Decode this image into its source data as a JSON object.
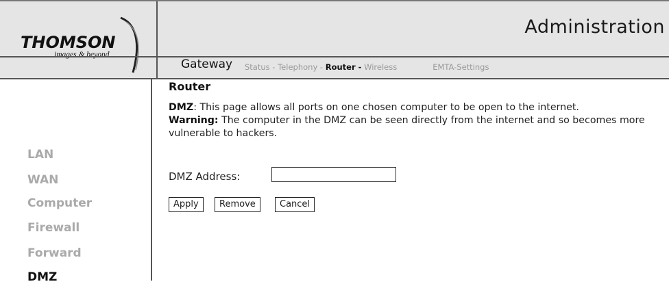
{
  "brand": {
    "name": "THOMSON",
    "tagline": "images & beyond"
  },
  "header": {
    "title": "Administration",
    "section": "Gateway",
    "nav": [
      {
        "label": "Status -",
        "active": false
      },
      {
        "label": "Telephony -",
        "active": false
      },
      {
        "label": "Router -",
        "active": true
      },
      {
        "label": "Wireless",
        "active": false
      },
      {
        "label": "EMTA-Settings",
        "active": false
      }
    ]
  },
  "sidebar": {
    "items": [
      {
        "label": "LAN",
        "active": false
      },
      {
        "label": "WAN",
        "active": false
      },
      {
        "label": "Computer",
        "active": false
      },
      {
        "label": "Firewall",
        "active": false
      },
      {
        "label": "Forward",
        "active": false
      },
      {
        "label": "DMZ",
        "active": true
      }
    ]
  },
  "main": {
    "title": "Router",
    "dmz_term": "DMZ",
    "dmz_desc": ": This page allows all ports on one chosen computer to be open to the internet.",
    "warning_term": "Warning:",
    "warning_desc": " The computer in the DMZ can be seen directly from the internet and so becomes more vulnerable to hackers.",
    "dmz_address_label": "DMZ Address:",
    "dmz_address_value": "",
    "buttons": {
      "apply": "Apply",
      "remove": "Remove",
      "cancel": "Cancel"
    }
  },
  "colors": {
    "header_bg": "#e5e5e5",
    "inactive_sidebar": "#aaaaaa",
    "active_text": "#111111"
  }
}
